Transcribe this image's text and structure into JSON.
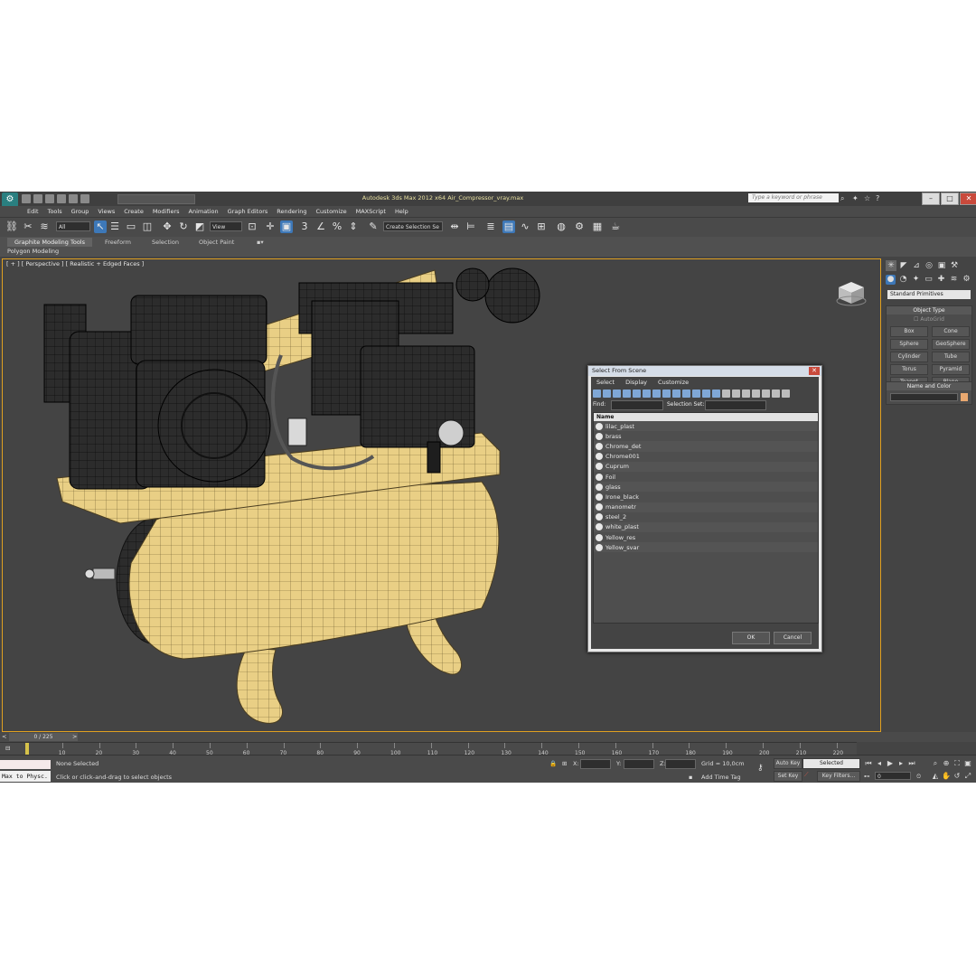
{
  "window": {
    "title": "Autodesk 3ds Max  2012 x64     Air_Compressor_vray.max",
    "search_placeholder": "Type a keyword or phrase"
  },
  "menu": [
    "Edit",
    "Tools",
    "Group",
    "Views",
    "Create",
    "Modifiers",
    "Animation",
    "Graph Editors",
    "Rendering",
    "Customize",
    "MAXScript",
    "Help"
  ],
  "toolbar": {
    "selection_filter": "All",
    "reference_coord": "View",
    "named_selection": "Create Selection Se"
  },
  "ribbon": {
    "tabs": [
      "Graphite Modeling Tools",
      "Freeform",
      "Selection",
      "Object Paint"
    ],
    "subtab": "Polygon Modeling"
  },
  "viewport": {
    "label": "[ + ] [ Perspective ] [ Realistic + Edged Faces ]"
  },
  "command_panel": {
    "category": "Standard Primitives",
    "object_type_title": "Object Type",
    "autogrid": "AutoGrid",
    "buttons": [
      "Box",
      "Cone",
      "Sphere",
      "GeoSphere",
      "Cylinder",
      "Tube",
      "Torus",
      "Pyramid",
      "Teapot",
      "Plane"
    ],
    "name_and_color": "Name and Color",
    "color": "#e8a870"
  },
  "dialog": {
    "title": "Select From Scene",
    "menu": [
      "Select",
      "Display",
      "Customize"
    ],
    "find_label": "Find:",
    "selection_set_label": "Selection Set:",
    "column_header": "Name",
    "items": [
      "lilac_plast",
      "brass",
      "Chrome_det",
      "Chrome001",
      "Cuprum",
      "Foil",
      "glass",
      "Irone_black",
      "manometr",
      "steel_2",
      "white_plast",
      "Yellow_res",
      "Yellow_svar"
    ],
    "ok": "OK",
    "cancel": "Cancel"
  },
  "timeline": {
    "slider": "0 / 225",
    "ticks": [
      "10",
      "20",
      "30",
      "40",
      "50",
      "60",
      "70",
      "80",
      "90",
      "100",
      "110",
      "120",
      "130",
      "140",
      "150",
      "160",
      "170",
      "180",
      "190",
      "200",
      "210",
      "220"
    ]
  },
  "status": {
    "maxscript_line1": "",
    "maxscript_line2": "Max to Physc.",
    "selection": "None Selected",
    "prompt": "Click or click-and-drag to select objects",
    "x_label": "X:",
    "y_label": "Y:",
    "z_label": "Z:",
    "grid": "Grid = 10,0cm",
    "add_time_tag": "Add Time Tag",
    "auto_key": "Auto Key",
    "key_mode": "Selected",
    "set_key": "Set Key",
    "key_filters": "Key Filters...",
    "frame": "0"
  }
}
